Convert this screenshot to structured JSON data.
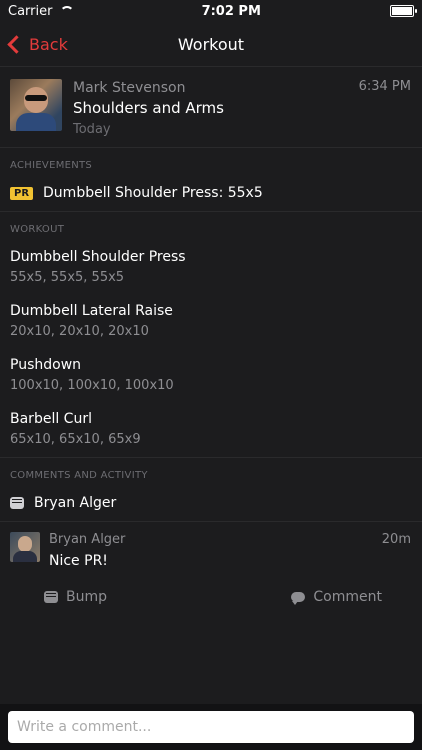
{
  "status": {
    "carrier": "Carrier",
    "time": "7:02 PM"
  },
  "nav": {
    "back_label": "Back",
    "title": "Workout"
  },
  "header": {
    "name": "Mark Stevenson",
    "workout_title": "Shoulders and Arms",
    "date": "Today",
    "time": "6:34 PM"
  },
  "sections": {
    "achievements": "ACHIEVEMENTS",
    "workout": "WORKOUT",
    "comments": "COMMENTS AND ACTIVITY"
  },
  "achievement": {
    "badge": "PR",
    "text": "Dumbbell Shoulder Press: 55x5"
  },
  "exercises": [
    {
      "name": "Dumbbell Shoulder Press",
      "sets": "55x5, 55x5, 55x5"
    },
    {
      "name": "Dumbbell Lateral Raise",
      "sets": "20x10, 20x10, 20x10"
    },
    {
      "name": "Pushdown",
      "sets": "100x10, 100x10, 100x10"
    },
    {
      "name": "Barbell Curl",
      "sets": "65x10, 65x10, 65x9"
    }
  ],
  "activity": {
    "bump_user": "Bryan Alger",
    "comment": {
      "name": "Bryan Alger",
      "text": "Nice PR!",
      "time": "20m"
    }
  },
  "actions": {
    "bump": "Bump",
    "comment": "Comment"
  },
  "composer": {
    "placeholder": "Write a comment..."
  },
  "colors": {
    "accent": "#e23b3b",
    "pr_badge": "#f1c232",
    "background": "#1c1c1e"
  }
}
